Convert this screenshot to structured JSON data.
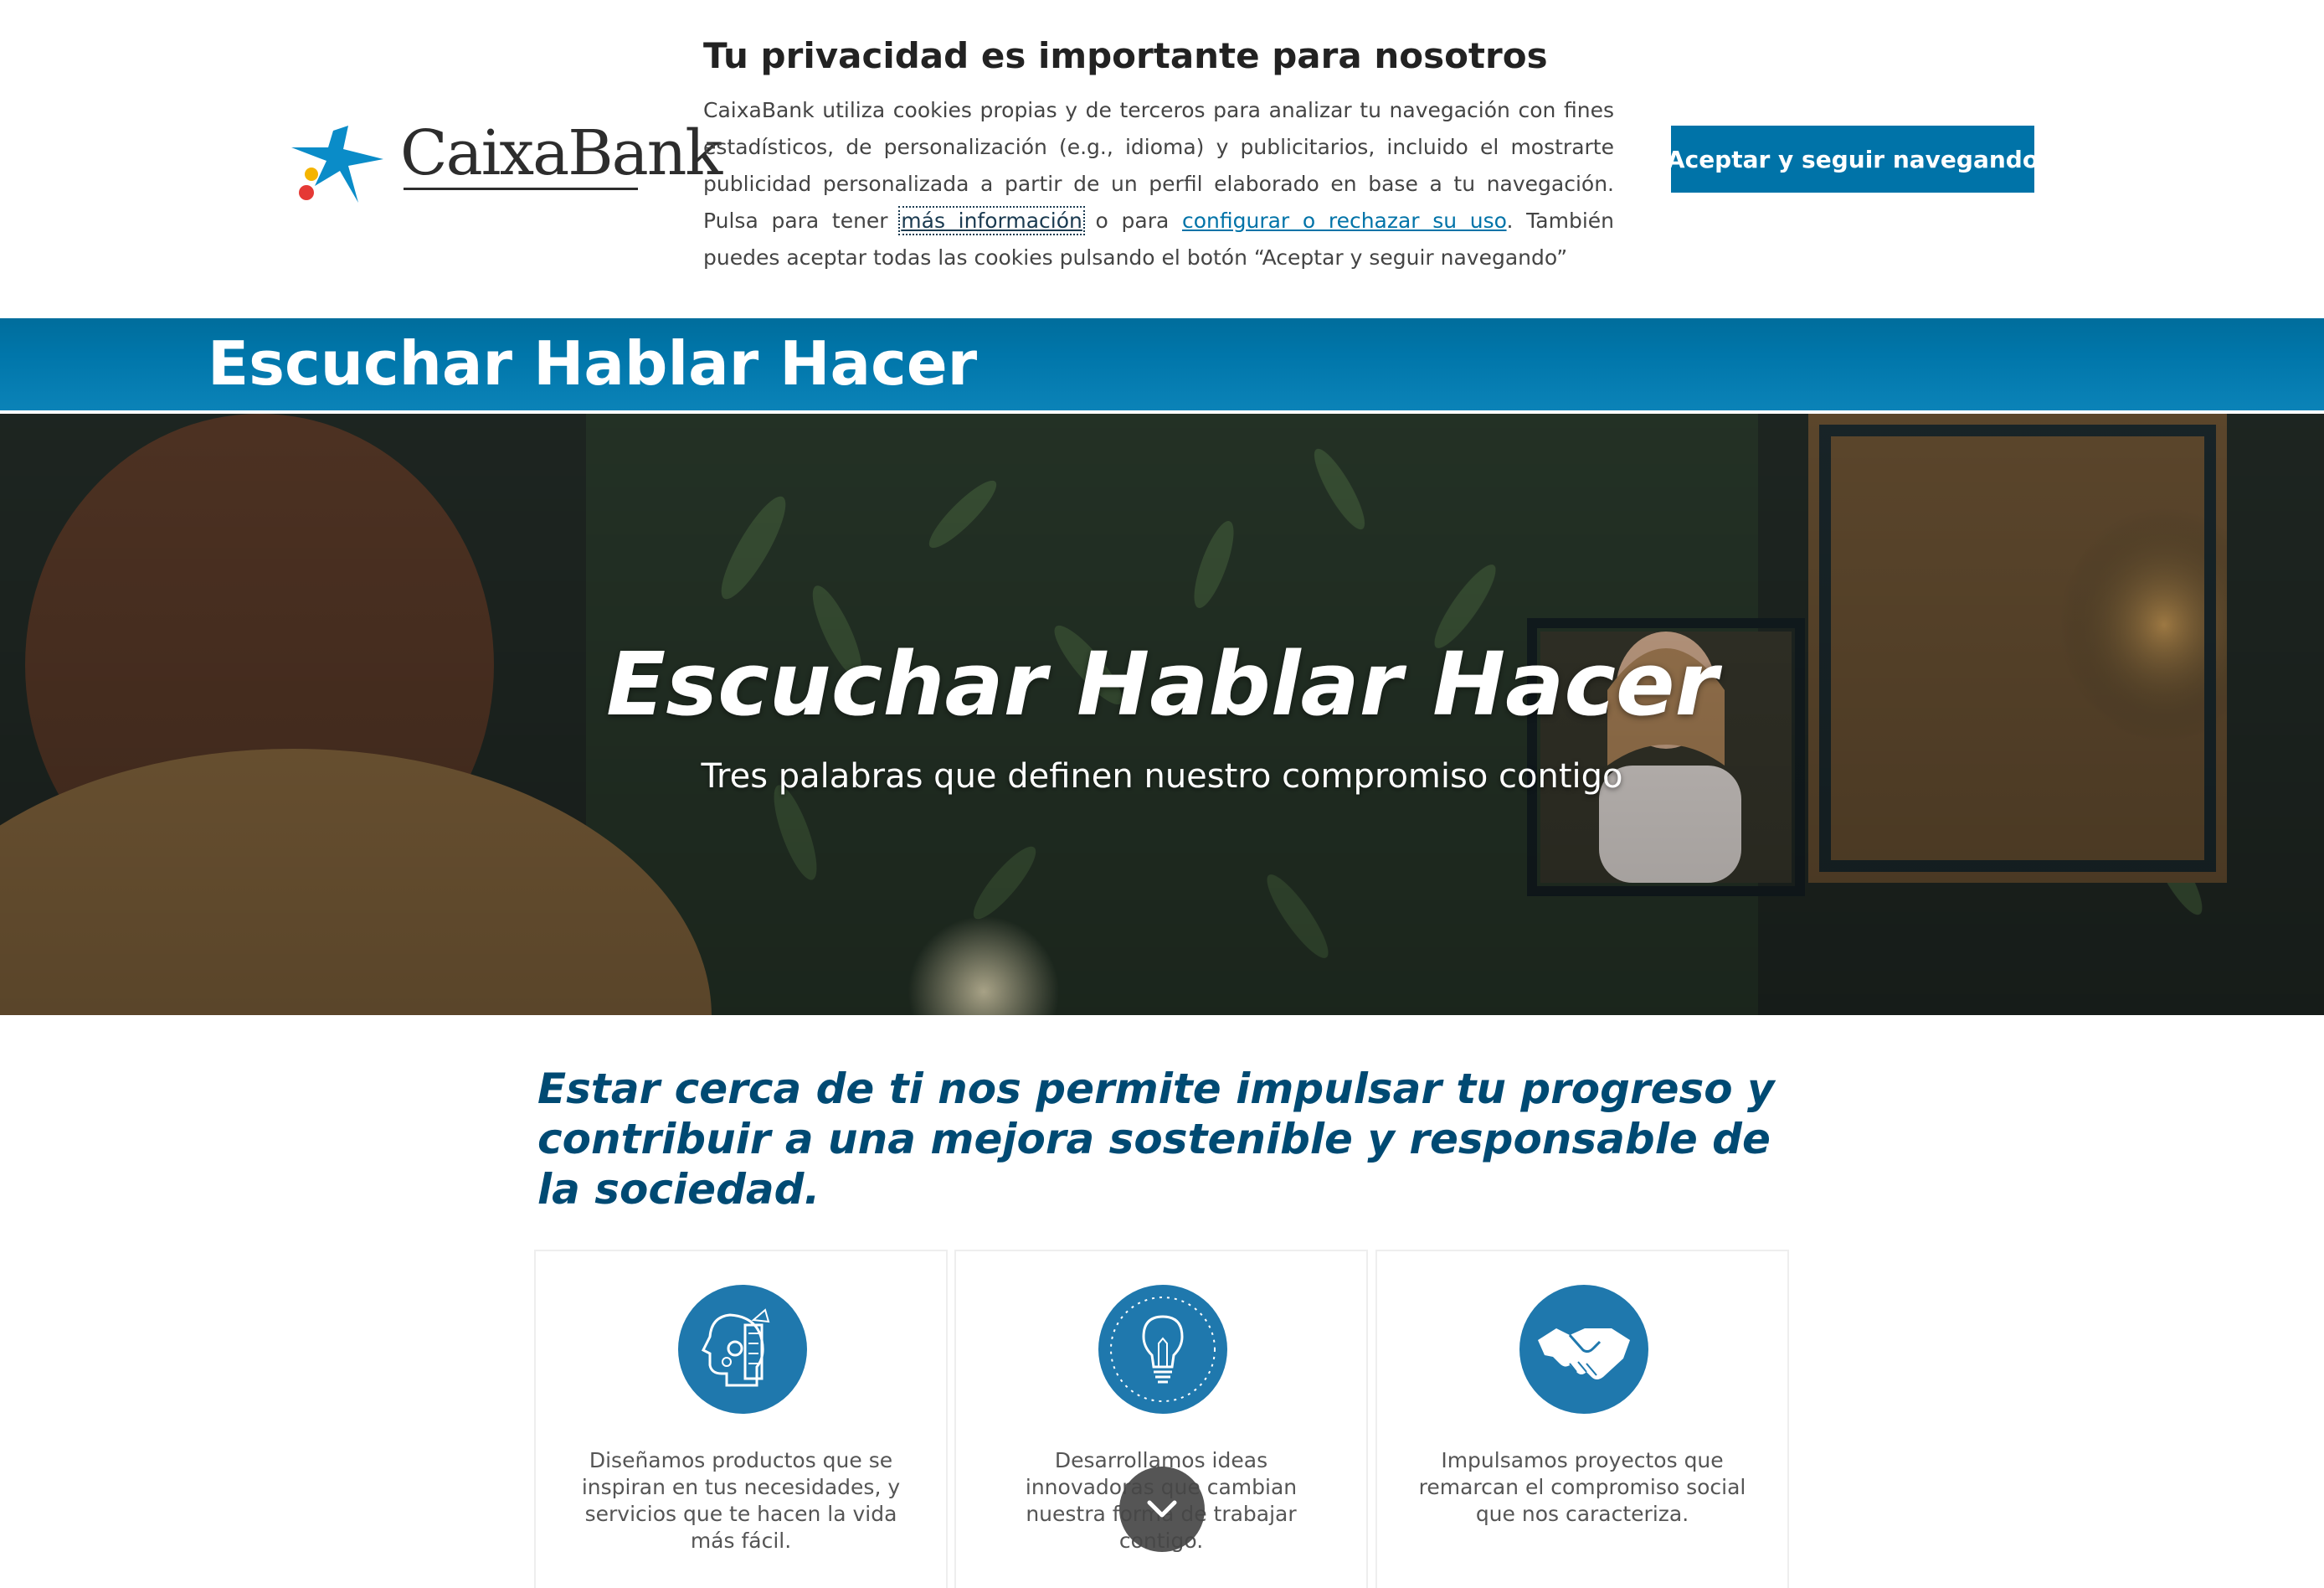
{
  "cookie_banner": {
    "logo_text": "CaixaBank",
    "title": "Tu privacidad es importante para nosotros",
    "text_part1": "CaixaBank utiliza cookies propias y de terceros para analizar tu navegación con fines estadísticos, de personalización (e.g., idioma) y publicitarios, incluido el mostrarte publicidad personalizada a partir de un perfil elaborado en base a tu navegación. Pulsa para tener ",
    "link_more_info": "más información",
    "text_part2": " o para ",
    "link_configure": "configurar o rechazar su uso",
    "text_part3": ". También puedes aceptar todas las cookies pulsando el botón “Aceptar y seguir navegando”",
    "accept_button": "Aceptar y seguir navegando"
  },
  "header": {
    "title": "Escuchar Hablar Hacer"
  },
  "hero": {
    "title": "Escuchar Hablar Hacer",
    "subtitle": "Tres palabras que definen nuestro compromiso contigo"
  },
  "intro": {
    "headline": "Estar cerca de ti nos permite impulsar tu progreso y contribuir a una mejora sostenible y responsable de la sociedad."
  },
  "cards": [
    {
      "icon": "head-gears-icon",
      "text": "Diseñamos productos que se inspiran en tus necesidades, y servicios que te hacen la vida más fácil."
    },
    {
      "icon": "lightbulb-icon",
      "text": "Desarrollamos ideas innovadoras que cambian nuestra forma de trabajar contigo."
    },
    {
      "icon": "handshake-icon",
      "text": "Impulsamos proyectos que remarcan el compromiso social que nos caracteriza."
    }
  ],
  "colors": {
    "brand_blue": "#0073a8",
    "headline_blue": "#004a73",
    "icon_blue": "#1f78ad"
  },
  "scroll_button": {
    "icon": "chevron-down-icon"
  }
}
